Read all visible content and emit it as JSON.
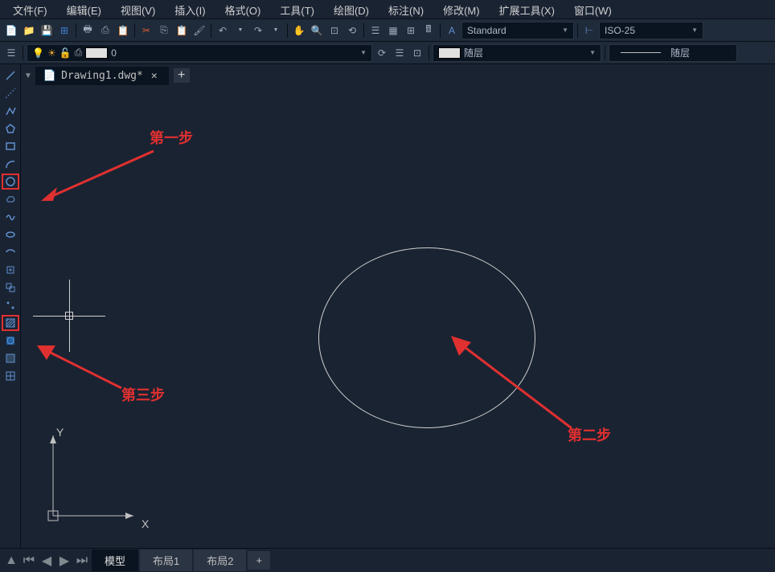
{
  "menubar": [
    {
      "label": "文件(F)"
    },
    {
      "label": "编辑(E)"
    },
    {
      "label": "视图(V)"
    },
    {
      "label": "插入(I)"
    },
    {
      "label": "格式(O)"
    },
    {
      "label": "工具(T)"
    },
    {
      "label": "绘图(D)"
    },
    {
      "label": "标注(N)"
    },
    {
      "label": "修改(M)"
    },
    {
      "label": "扩展工具(X)"
    },
    {
      "label": "窗口(W)"
    }
  ],
  "toolbar1": {
    "text_style": "Standard",
    "dim_style": "ISO-25"
  },
  "toolbar2": {
    "layer_name": "0",
    "color_value": "随层",
    "linetype_value": "随层"
  },
  "tab": {
    "filename": "Drawing1.dwg*"
  },
  "annotations": {
    "step1": "第一步",
    "step2": "第二步",
    "step3": "第三步"
  },
  "axis": {
    "x": "X",
    "y": "Y"
  },
  "bottom_tabs": {
    "model": "模型",
    "layout1": "布局1",
    "layout2": "布局2",
    "add": "+"
  }
}
